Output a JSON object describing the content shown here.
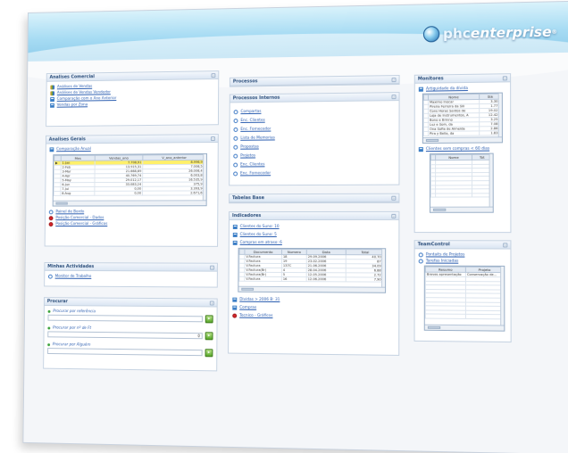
{
  "brand": {
    "name_a": "phc",
    "name_b": "enterprise",
    "tm": "®"
  },
  "col1": {
    "analises_comercial": {
      "title": "Analises Comercial",
      "links": [
        "Análises de Vendas",
        "Análises de Vendas Vendedor",
        "Comparação com o Ano Anterior",
        "Vendas por Zona"
      ]
    },
    "analises_gerais": {
      "title": "Analises Gerais",
      "top_link": "Comparação Anual",
      "grid": {
        "headers": [
          "",
          "Mes",
          "Vendas_ano",
          "V_ano_anterior"
        ],
        "rows": [
          [
            "▶",
            "1-Jan",
            "7.708,91",
            "8.996,96"
          ],
          [
            "",
            "2-Feb",
            "13.915,31",
            "7.006,54"
          ],
          [
            "",
            "3-Mar",
            "21.668,69",
            "26.006,40"
          ],
          [
            "",
            "4-Apr",
            "40.769,74",
            "6.003,84"
          ],
          [
            "",
            "5-May",
            "29.012,17",
            "16.535,96"
          ],
          [
            "",
            "6-Jun",
            "33.083,24",
            "375,91"
          ],
          [
            "",
            "7-Jul",
            "0,00",
            "3.393,94"
          ],
          [
            "",
            "8-Aug",
            "0,00",
            "2.671,68"
          ]
        ],
        "selected_row": 0
      },
      "links": [
        "Painel de Bordo",
        "Posição Comercial - Dados",
        "Posição Comercial - Gráficos"
      ]
    },
    "minhas_actividades": {
      "title": "Minhas Actividades",
      "links": [
        "Monitor de Trabalho"
      ]
    },
    "procurar": {
      "title": "Procurar",
      "fields": [
        {
          "label": "Procurar por referência",
          "value": ""
        },
        {
          "label": "Procurar por nº de Ft",
          "value": "0"
        },
        {
          "label": "Procurar por Alguém",
          "value": ""
        }
      ]
    }
  },
  "col2": {
    "processos": {
      "title": "Processos"
    },
    "processos_internos": {
      "title": "Processos Internos",
      "links": [
        "Compartas",
        "Enc. Clientes",
        "Enc. Fornecedor",
        "Lista de Memorias",
        "Propostas",
        "Projetos",
        "Enc. Clientes",
        "Enc. Fornecedor"
      ]
    },
    "tabelas_base": {
      "title": "Tabelas Base"
    },
    "indicadores": {
      "title": "Indicadores",
      "top_links": [
        "Clientes do Suno: 10",
        "Clientes do Suno: 5",
        "Compras em atraso: 6"
      ],
      "grid": {
        "headers": [
          "",
          "Documento",
          "Numero",
          "Data",
          "Total"
        ],
        "rows": [
          [
            "",
            "V.Factura",
            "18",
            "29.09.2006",
            "40.706"
          ],
          [
            "",
            "V.Factura",
            "19",
            "23.02.2006",
            "872"
          ],
          [
            "",
            "V.Factura",
            "137C",
            "21.06.2006",
            "34.096"
          ],
          [
            "",
            "V.Factura(Br)",
            "4",
            "28.04.2006",
            "6.882"
          ],
          [
            "",
            "V.Factura(Br)",
            "5",
            "12.05.2006",
            "2.720"
          ],
          [
            "",
            "V.Factura",
            "16",
            "12.06.2006",
            "7.905"
          ]
        ]
      },
      "links": [
        "Dividas > 2006 B: 31",
        "Compras",
        "Tecnico - Gráficos"
      ]
    }
  },
  "col3": {
    "monitores": {
      "title": "Monitores",
      "link1": "Artiguidade da dívida",
      "grid1": {
        "headers": [
          "",
          "Nome",
          "Stk"
        ],
        "rows": [
          [
            "",
            "Maximo Inocar",
            "3.304"
          ],
          [
            "",
            "Pireira Ferreira da Sili",
            "1.776"
          ],
          [
            "",
            "Cons Horas Santos de",
            "19.020"
          ],
          [
            "",
            "Loja de Instrumentos, A",
            "12.427"
          ],
          [
            "",
            "Bono e Brinno",
            "3.256"
          ],
          [
            "",
            "Luz e Som, da",
            "7.082"
          ],
          [
            "",
            "Ona Sofia de Almeida",
            "2.867"
          ],
          [
            "",
            "Pira y Bella, da",
            "1.838"
          ]
        ]
      },
      "link2": "Clientes sem compras < 60 dias",
      "grid2": {
        "headers": [
          "",
          "Nome",
          "Tot"
        ]
      }
    },
    "teamcontrol": {
      "title": "TeamControl",
      "links": [
        "Pontaits de Projetos",
        "Tarefas Iniciadas"
      ],
      "grid": {
        "headers": [
          "Resumo",
          "Projeto"
        ],
        "rows": [
          [
            "Breves apresentação",
            "Conservação de..."
          ]
        ]
      }
    }
  },
  "colors": {
    "link": "#2a5db0",
    "header_blue": "#a6dbf3",
    "panel_title": "#2c4f7c",
    "highlight": "#fff06a"
  }
}
